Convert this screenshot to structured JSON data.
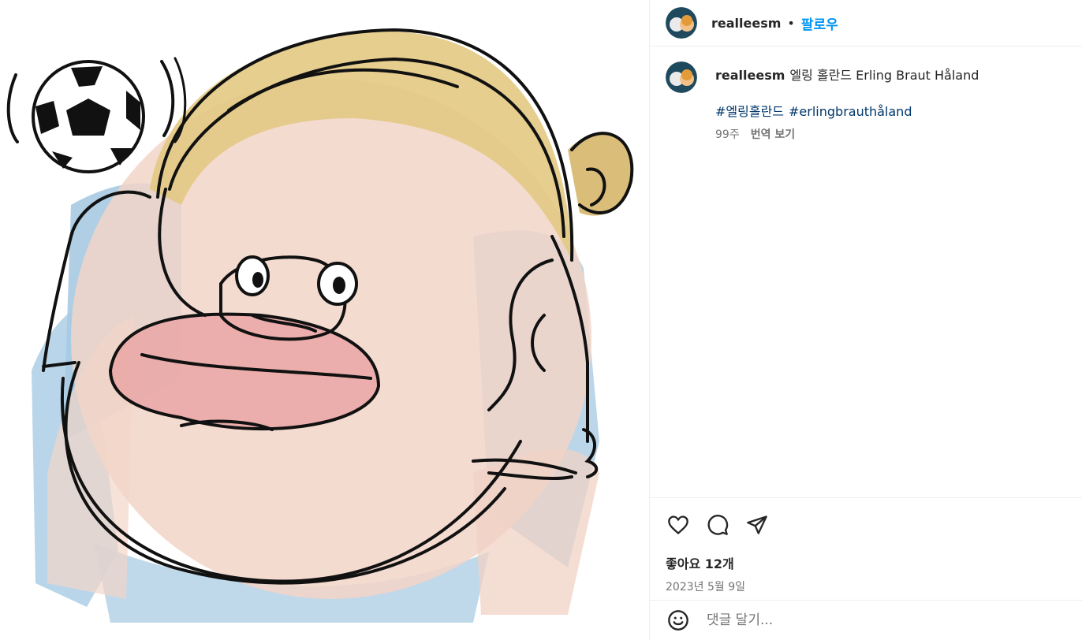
{
  "post": {
    "username": "realleesm",
    "follow_label": "팔로우",
    "caption_text": "엘링 홀란드 Erling Braut Håland",
    "hashtags": [
      "#엘링홀란드",
      "#erlingbrauthåland"
    ],
    "age": "99주",
    "translate_label": "번역 보기",
    "likes": "좋아요 12개",
    "date": "2023년 5월 9일",
    "comment_placeholder": "댓글 달기..."
  },
  "icons": {
    "like": "heart-icon",
    "comment": "comment-bubble-icon",
    "share": "paper-plane-icon",
    "emoji": "smiley-icon"
  },
  "colors": {
    "follow": "#0095f6",
    "hashtag": "#00376b",
    "muted": "#737373",
    "divider": "#efefef"
  }
}
